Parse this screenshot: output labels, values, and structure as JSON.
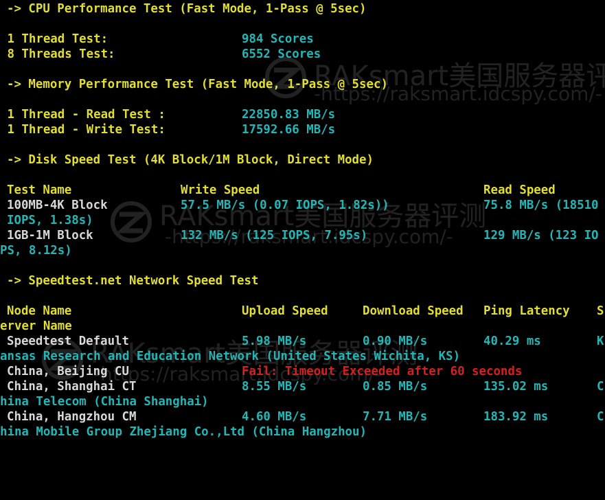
{
  "terminal": {
    "cpu": {
      "header": "-> CPU Performance Test (Fast Mode, 1-Pass @ 5sec)",
      "rows": [
        {
          "label": " 1 Thread Test:",
          "value": "984 Scores"
        },
        {
          "label": " 8 Threads Test:",
          "value": "6552 Scores"
        }
      ]
    },
    "memory": {
      "header": "-> Memory Performance Test (Fast Mode, 1-Pass @ 5sec)",
      "rows": [
        {
          "label": " 1 Thread - Read Test :",
          "value": "22850.83 MB/s"
        },
        {
          "label": " 1 Thread - Write Test:",
          "value": "17592.66 MB/s"
        }
      ]
    },
    "disk": {
      "header": "-> Disk Speed Test (4K Block/1M Block, Direct Mode)",
      "columns": {
        "name": "Test Name",
        "write": "Write Speed",
        "read": "Read Speed"
      },
      "rows": [
        {
          "name": "100MB-4K Block",
          "write": "57.5 MB/s (0.07 IOPS, 1.82s))",
          "read": "75.8 MB/s (18510",
          "wrap": "IOPS, 1.38s)"
        },
        {
          "name": "1GB-1M Block",
          "write": "132 MB/s (125 IOPS, 7.95s)",
          "read": "129 MB/s (123 IO",
          "wrap": "PS, 8.12s)"
        }
      ]
    },
    "network": {
      "header": "-> Speedtest.net Network Speed Test",
      "columns": {
        "node": "Node Name",
        "upload": "Upload Speed",
        "download": "Download Speed",
        "ping": "Ping Latency",
        "server_start": "S",
        "server_wrap": "erver Name"
      },
      "rows": [
        {
          "node": "Speedtest Default",
          "upload": "5.98 MB/s",
          "download": "0.90 MB/s",
          "ping": "40.29 ms",
          "server_start": "K",
          "server_wrap": "ansas Research and Education Network (United States Wichita, KS)"
        },
        {
          "node": "China, Beijing CU",
          "fail": "Fail: Timeout Exceeded after 60 seconds"
        },
        {
          "node": "China, Shanghai CT",
          "upload": "8.55 MB/s",
          "download": "0.85 MB/s",
          "ping": "135.02 ms",
          "server_start": "C",
          "server_wrap": "hina Telecom (China Shanghai)"
        },
        {
          "node": "China, Hangzhou CM",
          "upload": "4.60 MB/s",
          "download": "7.71 MB/s",
          "ping": "183.92 ms",
          "server_start": "C",
          "server_wrap": "hina Mobile Group Zhejiang Co.,Ltd (China Hangzhou)"
        }
      ]
    }
  },
  "watermark": {
    "brand": "RAKsmart美国服务器评测",
    "url": "-https://raksmart.idcspy.com/-"
  }
}
